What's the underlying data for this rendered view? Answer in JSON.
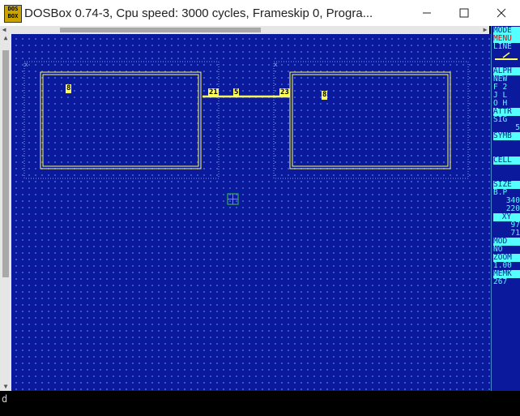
{
  "window": {
    "title": "DOSBox 0.74-3, Cpu speed:     3000 cycles, Frameskip  0, Progra...",
    "icon_text": "DOS BOX",
    "minimize_icon": "minimize-icon",
    "maximize_icon": "maximize-icon",
    "close_icon": "close-icon"
  },
  "canvas": {
    "block_left": {
      "origin_mark": "x",
      "label": "8"
    },
    "block_right": {
      "origin_mark": "x",
      "label": "8"
    },
    "wire": {
      "start_tag": "21",
      "mid_tag": "5",
      "end_tag": "23"
    },
    "cursor_icon": "crosshair-cursor-icon"
  },
  "panel": {
    "mode": "MODE",
    "menu": "MENU",
    "line": "LINE",
    "alph": "ALPH",
    "new": "NEW",
    "f": "F  2",
    "j": "J  L",
    "o": "O  H",
    "attr": "ATTR",
    "sig": "SIG",
    "sig_value": "5",
    "symb": "SYMB",
    "cell": "CELL",
    "size": "SIZE",
    "bp": "B.P",
    "size_x": "340",
    "size_y": "220",
    "xy": "XY",
    "xy_x": "97",
    "xy_y": "71",
    "mod": "MOD",
    "mod_value": "NO",
    "zoom": "ZOOM",
    "zoom_value": "1.00",
    "memk": "MEMK",
    "memk_value": "267"
  },
  "status": {
    "prompt": "d"
  },
  "colors": {
    "canvas_bg": "#0b1a9c",
    "grid_dot": "#3d6ad6",
    "wire": "#ffff55",
    "panel_text": "#55ffff",
    "menu_text": "#ee0000"
  }
}
